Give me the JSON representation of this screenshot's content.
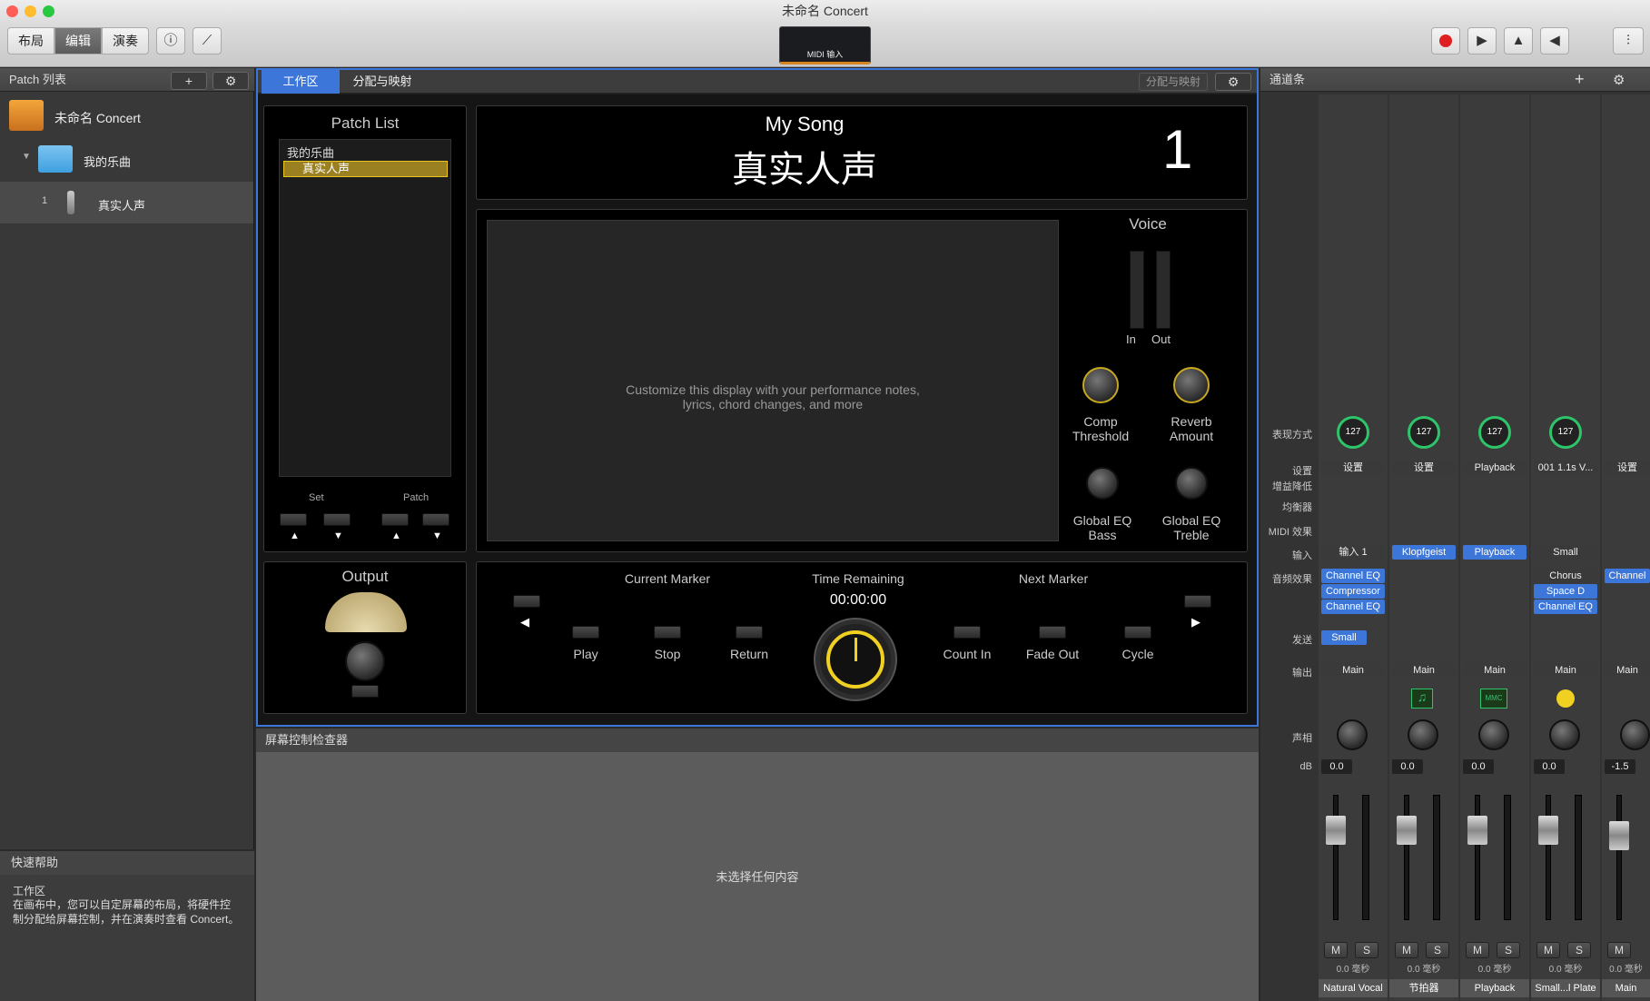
{
  "window": {
    "title": "未命名 Concert"
  },
  "toolbar": {
    "layout": "布局",
    "edit": "编辑",
    "perform": "演奏",
    "lcd_label": "MIDI 输入"
  },
  "patch_list": {
    "header": "Patch 列表",
    "concert": "未命名 Concert",
    "set": "我的乐曲",
    "patch_num": "1",
    "patch": "真实人声"
  },
  "quick_help": {
    "header": "快速帮助",
    "title": "工作区",
    "body": "在画布中，您可以自定屏幕的布局，将硬件控制分配给屏幕控制，并在演奏时查看 Concert。"
  },
  "workspace": {
    "tab_workspace": "工作区",
    "tab_assign": "分配与映射",
    "right_assign": "分配与映射"
  },
  "perf": {
    "patch_list_title": "Patch List",
    "list_set": "我的乐曲",
    "list_patch": "真实人声",
    "set_label": "Set",
    "patch_label": "Patch",
    "song": "My Song",
    "patch_big": "真实人声",
    "number": "1",
    "notes": "Customize this display with your performance notes, lyrics, chord changes, and more",
    "voice": "Voice",
    "in": "In",
    "out": "Out",
    "comp": "Comp\nThreshold",
    "reverb": "Reverb\nAmount",
    "eq_bass": "Global EQ\nBass",
    "eq_treble": "Global EQ\nTreble",
    "output": "Output",
    "current_marker": "Current Marker",
    "time_remaining": "Time Remaining",
    "time": "00:00:00",
    "next_marker": "Next Marker",
    "play": "Play",
    "stop": "Stop",
    "return": "Return",
    "count_in": "Count In",
    "fade_out": "Fade Out",
    "cycle": "Cycle"
  },
  "inspector": {
    "header": "屏幕控制检查器",
    "empty": "未选择任何内容"
  },
  "channel": {
    "header": "通道条",
    "labels": {
      "mode": "表现方式",
      "settings": "设置",
      "gain": "增益降低",
      "eq": "均衡器",
      "midi": "MIDI 效果",
      "input": "输入",
      "audio": "音频效果",
      "send": "发送",
      "output": "输出",
      "pan": "声相",
      "db": "dB"
    },
    "strips": [
      {
        "vel": "127",
        "setting": "设置",
        "input": "输入 1",
        "fx": [
          "Channel EQ",
          "Compressor",
          "Channel EQ"
        ],
        "send": "Small",
        "out": "Main",
        "db": "0.0",
        "m": "M",
        "s": "S",
        "ms": "0.0 毫秒",
        "name": "Natural Vocal"
      },
      {
        "vel": "127",
        "setting": "设置",
        "input": "Klopfgeist",
        "fx": [],
        "send": "",
        "out": "Main",
        "db": "0.0",
        "m": "M",
        "s": "S",
        "ms": "0.0 毫秒",
        "name": "节拍器"
      },
      {
        "vel": "127",
        "setting": "Playback",
        "input": "Playback",
        "fx": [],
        "send": "",
        "out": "Main",
        "db": "0.0",
        "m": "M",
        "s": "S",
        "ms": "0.0 毫秒",
        "name": "Playback"
      },
      {
        "vel": "127",
        "setting": "001 1.1s V...",
        "input": "Small",
        "fx": [
          "Chorus",
          "Space D",
          "Channel EQ"
        ],
        "send": "",
        "out": "Main",
        "db": "0.0",
        "m": "M",
        "s": "S",
        "ms": "0.0 毫秒",
        "name": "Small...l Plate"
      },
      {
        "vel": "",
        "setting": "设置",
        "input": "",
        "fx": [
          "Channel"
        ],
        "send": "",
        "out": "Main",
        "db": "-1.5",
        "m": "M",
        "s": "",
        "ms": "0.0 毫秒",
        "name": "Main"
      }
    ]
  },
  "colors": {
    "accent": "#3d76d9",
    "gold": "#f0d020",
    "record": "#e02020"
  }
}
